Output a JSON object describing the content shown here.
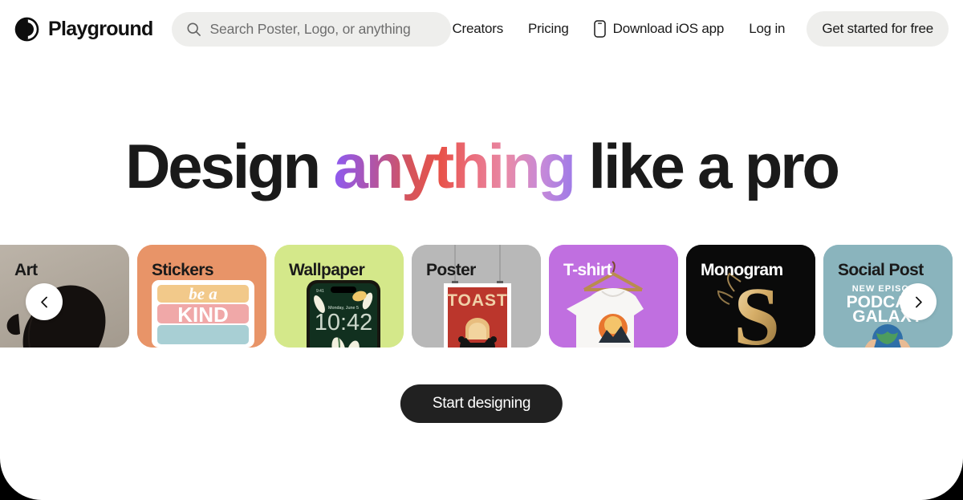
{
  "brand": {
    "name": "Playground",
    "logo_icon": "playground-circle-logo"
  },
  "search": {
    "placeholder": "Search Poster, Logo, or anything",
    "value": "",
    "icon": "search-icon"
  },
  "nav": {
    "links": [
      {
        "label": "Creators",
        "icon": null
      },
      {
        "label": "Pricing",
        "icon": null
      },
      {
        "label": "Download iOS app",
        "icon": "phone-icon"
      },
      {
        "label": "Log in",
        "icon": null
      }
    ],
    "cta_label": "Get started for free"
  },
  "hero": {
    "title_part1": "Design ",
    "title_gradient": "anything",
    "title_part2": " like a pro",
    "gradient_colors": [
      "#8b5cf6",
      "#d4545c",
      "#e8534a",
      "#e88aa8",
      "#9d7ae8"
    ]
  },
  "carousel": {
    "prev_icon": "chevron-left-icon",
    "next_icon": "chevron-right-icon",
    "cards": [
      {
        "label": "Art",
        "bg": "#b8b0a5",
        "label_color": "dark",
        "art": "art-portrait"
      },
      {
        "label": "Stickers",
        "bg": "#e89468",
        "label_color": "dark",
        "art": "stickers-be-a-kind"
      },
      {
        "label": "Wallpaper",
        "bg": "#d4e88a",
        "label_color": "dark",
        "art": "wallpaper-phone"
      },
      {
        "label": "Poster",
        "bg": "#b8b8b8",
        "label_color": "dark",
        "art": "poster-toast"
      },
      {
        "label": "T-shirt",
        "bg": "#c06fe0",
        "label_color": "light",
        "art": "tshirt-hanger"
      },
      {
        "label": "Monogram",
        "bg": "#0a0a0a",
        "label_color": "light",
        "art": "monogram-s"
      },
      {
        "label": "Social Post",
        "bg": "#8ab4bd",
        "label_color": "dark",
        "art": "social-podcast"
      }
    ],
    "card_art_text": {
      "stickers_line1": "be a",
      "stickers_line2": "KIND",
      "wallpaper_time": "10:42",
      "wallpaper_date": "Monday, June 5",
      "wallpaper_status": "9:41",
      "poster_title": "TOAST",
      "monogram_letter": "S",
      "social_line1": "NEW EPISODE",
      "social_line2": "PODCAST",
      "social_line3": "GALAXY"
    }
  },
  "footer_cta": {
    "label": "Start designing"
  },
  "colors": {
    "page_background": "#000000",
    "sheet_background": "#ffffff",
    "search_background": "#eeeeec",
    "text_primary": "#1a1a1a",
    "button_dark": "#212121"
  }
}
